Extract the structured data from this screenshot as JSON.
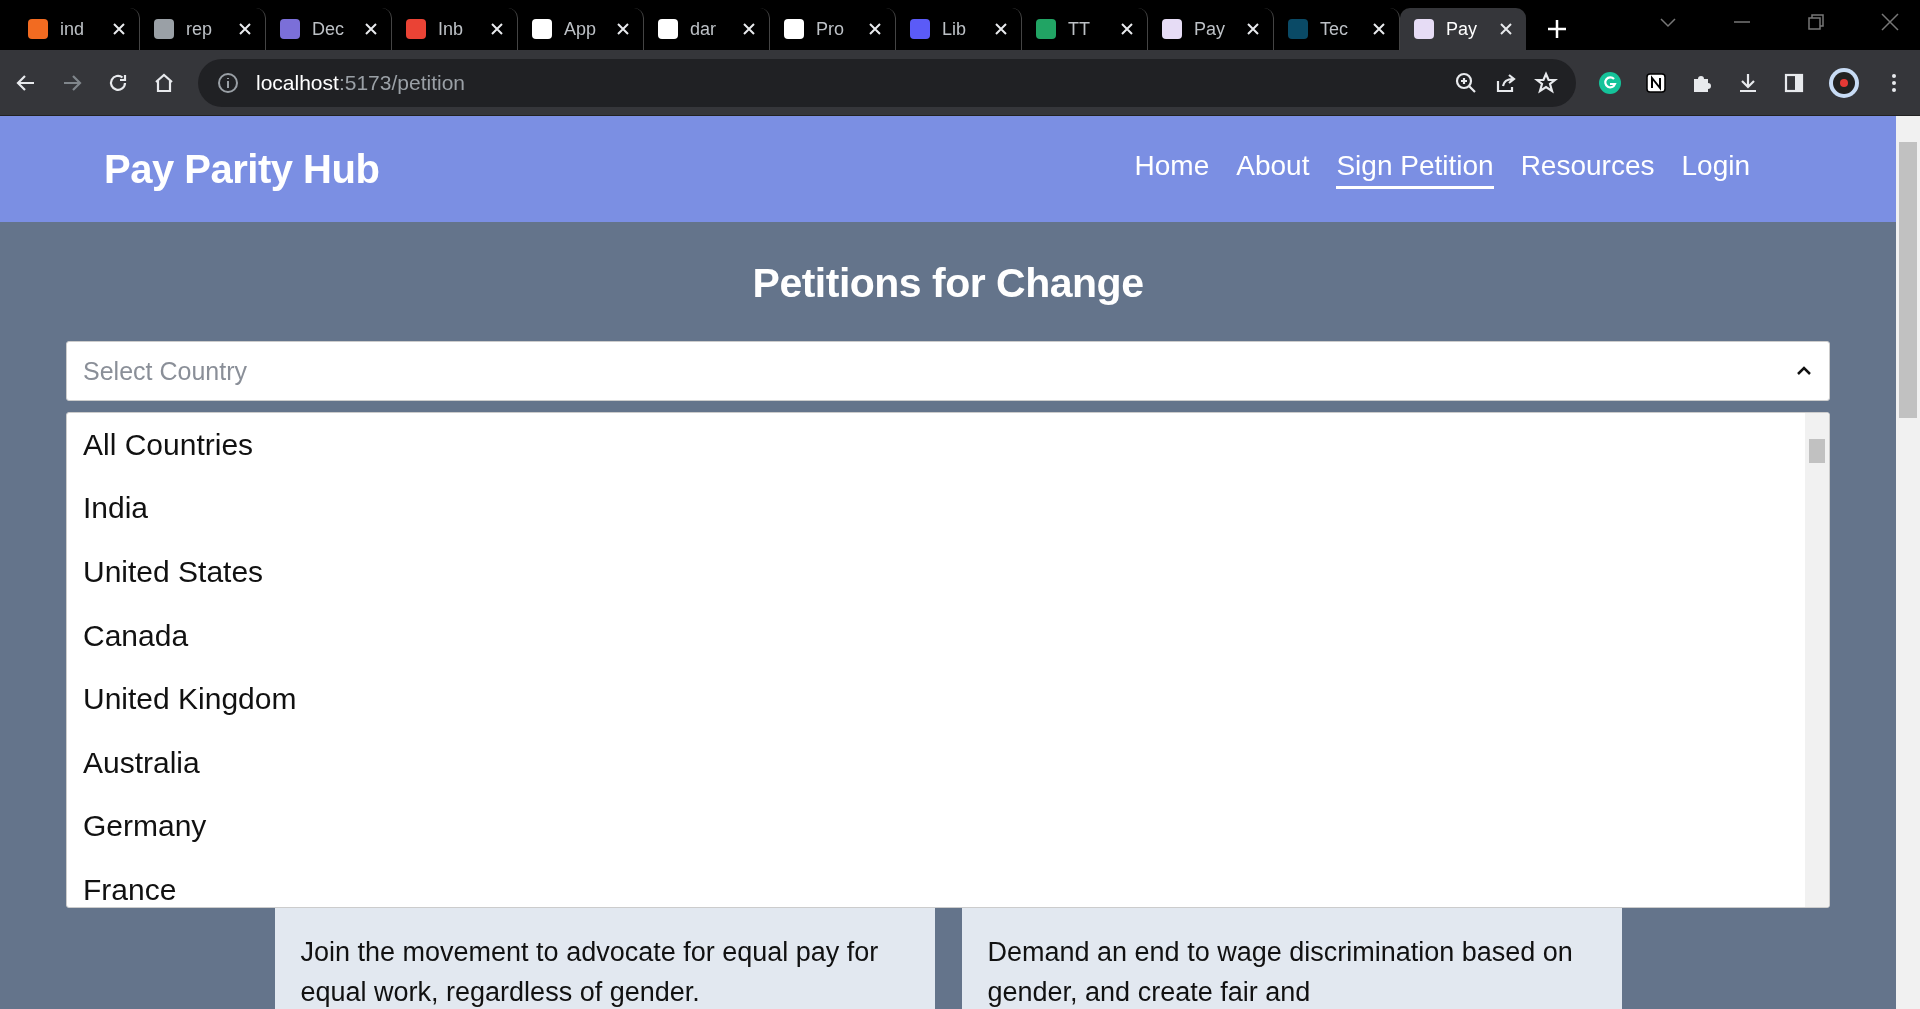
{
  "browser": {
    "tabs": [
      {
        "title": "ind",
        "selected": false,
        "color": "#f26b21"
      },
      {
        "title": "rep",
        "selected": false,
        "color": "#9aa0a6"
      },
      {
        "title": "Dec",
        "selected": false,
        "color": "#7b6fd8"
      },
      {
        "title": "Inb",
        "selected": false,
        "color": "#ea4335"
      },
      {
        "title": "App",
        "selected": false,
        "color": "#ffffff"
      },
      {
        "title": "dar",
        "selected": false,
        "color": "#ffffff"
      },
      {
        "title": "Pro",
        "selected": false,
        "color": "#ffffff"
      },
      {
        "title": "Lib",
        "selected": false,
        "color": "#5b5bf7"
      },
      {
        "title": "TT",
        "selected": false,
        "color": "#21a464"
      },
      {
        "title": "Pay",
        "selected": false,
        "color": "#e6dcf5"
      },
      {
        "title": "Tec",
        "selected": false,
        "color": "#0a4a66"
      },
      {
        "title": "Pay",
        "selected": true,
        "color": "#e6dcf5"
      }
    ],
    "url_host": "localhost",
    "url_rest": ":5173/petition"
  },
  "nav": {
    "brand": "Pay Parity Hub",
    "links": [
      {
        "label": "Home",
        "selected": false
      },
      {
        "label": "About",
        "selected": false
      },
      {
        "label": "Sign Petition",
        "selected": true
      },
      {
        "label": "Resources",
        "selected": false
      },
      {
        "label": "Login",
        "selected": false
      }
    ]
  },
  "heading": "Petitions for Change",
  "country_select": {
    "placeholder": "Select Country",
    "expanded": true,
    "options": [
      "All Countries",
      "India",
      "United States",
      "Canada",
      "United Kingdom",
      "Australia",
      "Germany",
      "France"
    ]
  },
  "cards": [
    {
      "text": "Join the movement to advocate for equal pay for equal work, regardless of gender."
    },
    {
      "text": "Demand an end to wage discrimination based on gender, and create fair and"
    }
  ]
}
